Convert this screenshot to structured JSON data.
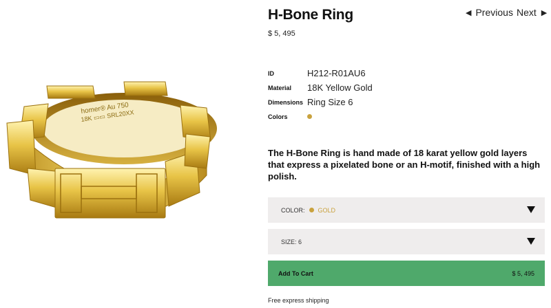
{
  "product": {
    "title": "H-Bone Ring",
    "price": "$ 5, 495",
    "engraving_line1": "homer® Au 750",
    "engraving_line2": "18K ▭▭ SRL20XX"
  },
  "nav": {
    "previous_label": "Previous",
    "next_label": "Next"
  },
  "specs": [
    {
      "label": "ID",
      "value": "H212-R01AU6"
    },
    {
      "label": "Material",
      "value": "18K Yellow Gold"
    },
    {
      "label": "Dimensions",
      "value": "Ring Size 6"
    },
    {
      "label": "Colors",
      "value": ""
    }
  ],
  "description": "The H-Bone Ring is hand made of 18 karat yellow gold layers that express a pixelated bone or an H-motif, finished with a high polish.",
  "options": {
    "color_label": "COLOR:",
    "color_value": "GOLD",
    "size_label": "SIZE: 6"
  },
  "cart": {
    "label": "Add To Cart",
    "price": "$ 5, 495"
  },
  "shipping_note": "Free express shipping",
  "colors": {
    "gold": "#c9a23e",
    "cart_green": "#4fa96b",
    "dropdown_bg": "#efeded"
  }
}
